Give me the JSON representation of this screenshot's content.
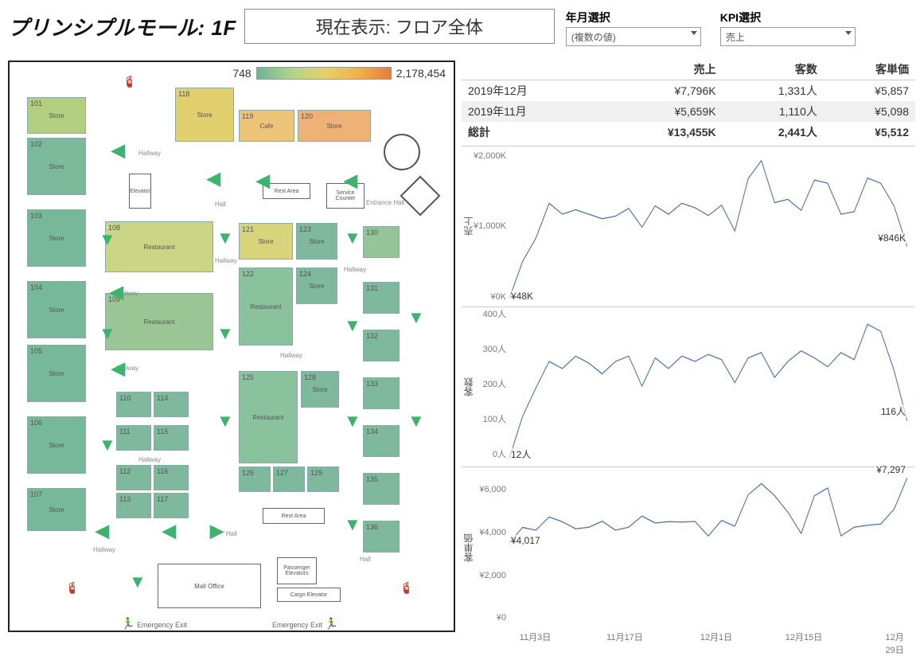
{
  "header": {
    "title": "プリンシプルモール: 1F",
    "current_display": "現在表示: フロア全体"
  },
  "filters": {
    "period": {
      "label": "年月選択",
      "value": "(複数の値)"
    },
    "kpi": {
      "label": "KPI選択",
      "value": "売上"
    }
  },
  "legend": {
    "min": "748",
    "max": "2,178,454"
  },
  "floorplan_labels": {
    "restaurant": "Restaurant",
    "store": "Store",
    "cafe": "Cafe",
    "rest_area": "Rest Area",
    "hallway": "Hallway",
    "hall": "Hall",
    "entrance_hall": "Entrance Hall",
    "service_counter": "Service\nCounter",
    "elevator": "Elevator",
    "mall_office": "Mall Office",
    "passenger_elevators": "Passenger\nElevators",
    "cargo_elevator": "Cargo Elevator",
    "emergency_exit": "Emergency Exit"
  },
  "table": {
    "cols": [
      "",
      "売上",
      "客数",
      "客単価"
    ],
    "rows": [
      {
        "label": "2019年12月",
        "sales": "¥7,796K",
        "visitors": "1,331人",
        "avg": "¥5,857"
      },
      {
        "label": "2019年11月",
        "sales": "¥5,659K",
        "visitors": "1,110人",
        "avg": "¥5,098"
      }
    ],
    "total": {
      "label": "総計",
      "sales": "¥13,455K",
      "visitors": "2,441人",
      "avg": "¥5,512"
    }
  },
  "chart_data": [
    {
      "type": "line",
      "title": "売上",
      "x": [
        "11/1",
        "11/3",
        "11/5",
        "11/7",
        "11/9",
        "11/11",
        "11/13",
        "11/15",
        "11/17",
        "11/19",
        "11/21",
        "11/23",
        "11/25",
        "11/27",
        "11/29",
        "12/1",
        "12/3",
        "12/5",
        "12/7",
        "12/9",
        "12/11",
        "12/13",
        "12/15",
        "12/17",
        "12/19",
        "12/21",
        "12/23",
        "12/25",
        "12/27",
        "12/29",
        "12/31"
      ],
      "y": [
        48,
        620,
        980,
        1520,
        1350,
        1420,
        1350,
        1280,
        1320,
        1440,
        1150,
        1480,
        1350,
        1520,
        1450,
        1330,
        1490,
        1090,
        1900,
        2180,
        1530,
        1580,
        1410,
        1880,
        1830,
        1350,
        1390,
        1910,
        1830,
        1480,
        846
      ],
      "y_ticks": [
        "¥0K",
        "¥1,000K",
        "¥2,000K"
      ],
      "first_label": "¥48K",
      "last_label": "¥846K",
      "ymax": 2300
    },
    {
      "type": "line",
      "title": "客数",
      "x": [
        "11/1",
        "11/3",
        "11/5",
        "11/7",
        "11/9",
        "11/11",
        "11/13",
        "11/15",
        "11/17",
        "11/19",
        "11/21",
        "11/23",
        "11/25",
        "11/27",
        "11/29",
        "12/1",
        "12/3",
        "12/5",
        "12/7",
        "12/9",
        "12/11",
        "12/13",
        "12/15",
        "12/17",
        "12/19",
        "12/21",
        "12/23",
        "12/25",
        "12/27",
        "12/29",
        "12/31"
      ],
      "y": [
        12,
        130,
        210,
        285,
        265,
        300,
        280,
        250,
        285,
        300,
        215,
        295,
        265,
        300,
        285,
        305,
        290,
        225,
        295,
        310,
        240,
        285,
        315,
        295,
        270,
        310,
        290,
        390,
        370,
        260,
        116
      ],
      "y_ticks": [
        "0人",
        "100人",
        "200人",
        "300人",
        "400人"
      ],
      "first_label": "12人",
      "last_label": "116人",
      "ymax": 420
    },
    {
      "type": "line",
      "title": "客単価",
      "x": [
        "11/1",
        "11/3",
        "11/5",
        "11/7",
        "11/9",
        "11/11",
        "11/13",
        "11/15",
        "11/17",
        "11/19",
        "11/21",
        "11/23",
        "11/25",
        "11/27",
        "11/29",
        "12/1",
        "12/3",
        "12/5",
        "12/7",
        "12/9",
        "12/11",
        "12/13",
        "12/15",
        "12/17",
        "12/19",
        "12/21",
        "12/23",
        "12/25",
        "12/27",
        "12/29",
        "12/31"
      ],
      "y": [
        4017,
        4790,
        4650,
        5320,
        5070,
        4720,
        4800,
        5100,
        4650,
        4800,
        5360,
        5010,
        5080,
        5060,
        5090,
        4360,
        5140,
        4850,
        6430,
        7000,
        6390,
        5560,
        4480,
        6380,
        6780,
        4360,
        4800,
        4900,
        4960,
        5700,
        7297
      ],
      "y_ticks": [
        "¥0",
        "¥2,000",
        "¥4,000",
        "¥6,000"
      ],
      "first_label": "¥4,017",
      "last_label": "¥7,297",
      "ymax": 7500
    }
  ],
  "x_ticks": [
    "11月3日",
    "11月17日",
    "12月1日",
    "12月15日",
    "12月29日"
  ],
  "x_tick_pos": [
    0.065,
    0.29,
    0.52,
    0.74,
    0.97
  ]
}
